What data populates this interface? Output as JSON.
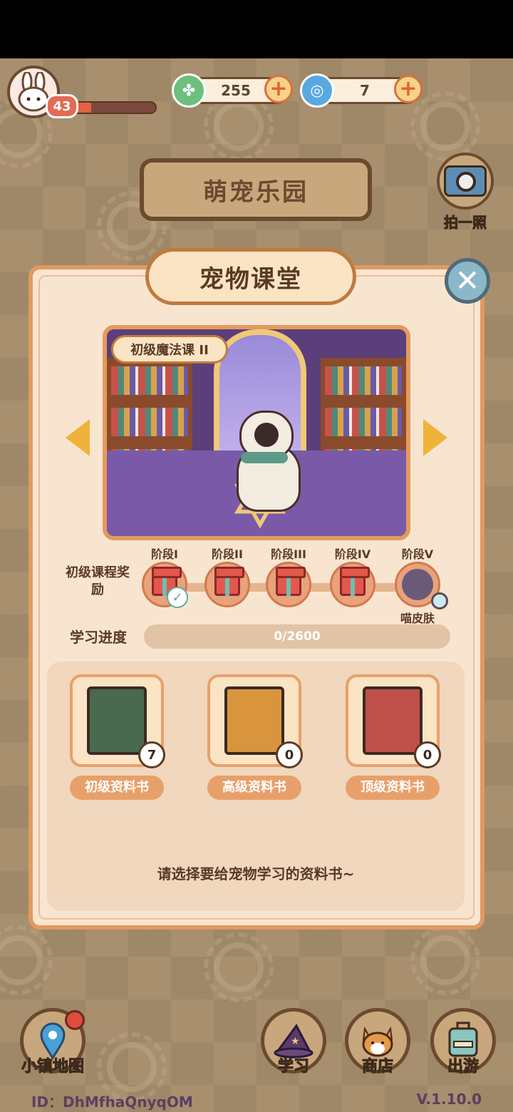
{
  "player": {
    "level": "43",
    "xp_fraction": 0.25,
    "avatar_icon": "bunny-avatar-icon"
  },
  "currencies": [
    {
      "name": "leaf",
      "icon": "clover-icon",
      "value": "255",
      "color": "#6cbf7d"
    },
    {
      "name": "swirl",
      "icon": "swirl-icon",
      "value": "7",
      "color": "#5aa8e0"
    }
  ],
  "header": {
    "title": "萌宠乐园",
    "camera_label": "拍一照"
  },
  "panel": {
    "title": "宠物课堂",
    "course_name": "初级魔法课 II",
    "reward_label": "初级课程奖励",
    "stages": [
      {
        "name": "阶段I",
        "type": "gift",
        "claimed": true
      },
      {
        "name": "阶段II",
        "type": "gift",
        "claimed": false
      },
      {
        "name": "阶段III",
        "type": "gift",
        "claimed": false
      },
      {
        "name": "阶段IV",
        "type": "gift",
        "claimed": false
      },
      {
        "name": "阶段V",
        "type": "skin",
        "claimed": false,
        "sub_label": "喵皮肤"
      }
    ],
    "progress_label": "学习进度",
    "progress_text": "0/2600",
    "progress_fraction": 0,
    "books": [
      {
        "label": "初级资料书",
        "count": "7",
        "color": "#4a6a50"
      },
      {
        "label": "高级资料书",
        "count": "0",
        "color": "#d9953e"
      },
      {
        "label": "顶级资料书",
        "count": "0",
        "color": "#c0504a"
      }
    ],
    "hint": "请选择要给宠物学习的资料书~"
  },
  "nav": {
    "map_label": "小镇地图",
    "study_label": "学习",
    "shop_label": "商店",
    "travel_label": "出游"
  },
  "footer": {
    "id_text": "ID：DhMfhaQnyqOM",
    "version": "V.1.10.0"
  }
}
